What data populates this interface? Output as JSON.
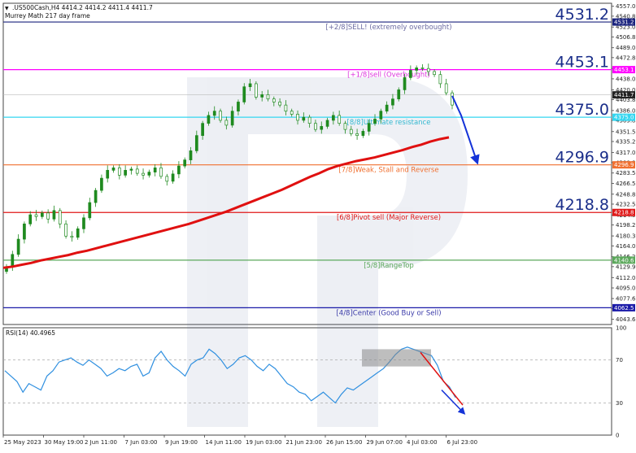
{
  "header": {
    "symbol_line": ".US500Cash,H4  4414.2 4414.2 4411.4 4411.7",
    "indicator_name": "Murrey Math 217 day frame"
  },
  "rsi": {
    "label": "RSI(14) 40.4965",
    "ticks": [
      "100",
      "70",
      "30",
      "0"
    ]
  },
  "colors": {
    "candle": "#1f8a1f",
    "ma": "#e01010",
    "rsi_line": "#3090e0",
    "arrow": "#1533d8",
    "big_label": "#1a2e8a"
  },
  "chart_data": [
    {
      "type": "candlestick",
      "title": ".US500Cash,H4",
      "ylim": [
        4035,
        4562
      ],
      "y_ticks": [
        "4557.0",
        "4540.8",
        "4523.0",
        "4506.8",
        "4489.0",
        "4472.8",
        "4455.0",
        "4438.0",
        "4420.0",
        "4403.8",
        "4386.0",
        "4369.8",
        "4351.5",
        "4335.2",
        "4317.0",
        "4300.8",
        "4283.5",
        "4266.5",
        "4248.8",
        "4232.5",
        "4214.5",
        "4198.2",
        "4180.3",
        "4164.0",
        "4146.2",
        "4129.9",
        "4112.0",
        "4095.0",
        "4077.6",
        "4060.8",
        "4043.6"
      ],
      "x_ticks": [
        "25 May 2023",
        "30 May 19:00",
        "2 Jun 11:00",
        "7 Jun 03:00",
        "9 Jun 19:00",
        "14 Jun 11:00",
        "19 Jun 03:00",
        "21 Jun 23:00",
        "26 Jun 15:00",
        "29 Jun 07:00",
        "4 Jul 03:00",
        "6 Jul 23:00"
      ],
      "current_price": "4411.7",
      "closes": [
        4130,
        4150,
        4175,
        4200,
        4215,
        4212,
        4218,
        4208,
        4222,
        4200,
        4180,
        4178,
        4192,
        4210,
        4235,
        4255,
        4275,
        4288,
        4292,
        4280,
        4288,
        4290,
        4283,
        4280,
        4285,
        4292,
        4278,
        4270,
        4282,
        4295,
        4305,
        4320,
        4345,
        4365,
        4378,
        4385,
        4370,
        4362,
        4385,
        4400,
        4425,
        4430,
        4408,
        4412,
        4405,
        4400,
        4395,
        4385,
        4380,
        4370,
        4375,
        4365,
        4355,
        4360,
        4370,
        4378,
        4365,
        4355,
        4348,
        4345,
        4352,
        4365,
        4372,
        4385,
        4395,
        4405,
        4420,
        4440,
        4452,
        4456,
        4455,
        4450,
        4445,
        4430,
        4415,
        4395
      ],
      "moving_average": {
        "label": "217 MA",
        "values": [
          4128,
          4130,
          4133,
          4136,
          4140,
          4143,
          4146,
          4149,
          4153,
          4156,
          4160,
          4164,
          4168,
          4172,
          4176,
          4180,
          4184,
          4188,
          4192,
          4196,
          4200,
          4205,
          4210,
          4215,
          4220,
          4226,
          4232,
          4238,
          4244,
          4250,
          4256,
          4263,
          4270,
          4277,
          4283,
          4290,
          4295,
          4299,
          4303,
          4306,
          4309,
          4313,
          4317,
          4321,
          4326,
          4330,
          4335,
          4339,
          4342
        ]
      },
      "murrey_levels": [
        {
          "price": 4531.2,
          "price_label": "4531.2",
          "big_label": "4531.2",
          "text": "[+2/8]SELL! (extremely overbought)",
          "color": "#1a237e",
          "text_color": "#6c6ca2",
          "dashed": false
        },
        {
          "price": 4453.1,
          "price_label": "4453.1",
          "big_label": "4453.1",
          "text": "[+1/8]sell (Overbought)",
          "color": "#ff00ff",
          "text_color": "#dd33dd",
          "dashed": false
        },
        {
          "price": 4375.0,
          "price_label": "4375.0",
          "big_label": "4375.0",
          "text": "[8/8]Ultimate resistance",
          "color": "#33d6f0",
          "text_color": "#33b8d0",
          "dashed": false
        },
        {
          "price": 4296.9,
          "price_label": "4296.9",
          "big_label": "4296.9",
          "text": "[7/8]Weak, Stall and Reverse",
          "color": "#f07030",
          "text_color": "#f07030",
          "dashed": false
        },
        {
          "price": 4218.8,
          "price_label": "4218.8",
          "big_label": "4218.8",
          "text": "[6/8]Pivot sell (Major Reverse)",
          "color": "#e01818",
          "text_color": "#e01818",
          "dashed": false
        },
        {
          "price": 4140.6,
          "price_label": "4140.6",
          "big_label": "",
          "text": "[5/8]RangeTop",
          "color": "#5ba85b",
          "text_color": "#5ba85b",
          "dashed": false
        },
        {
          "price": 4062.5,
          "price_label": "4062.5",
          "big_label": "",
          "text": "[4/8]Center (Good Buy or Sell)",
          "color": "#1a1aa8",
          "text_color": "#3a3aa8",
          "dashed": false
        }
      ]
    },
    {
      "type": "line",
      "title": "RSI(14) 40.4965",
      "ylim": [
        0,
        100
      ],
      "levels": [
        70,
        30
      ],
      "values": [
        60,
        55,
        50,
        40,
        48,
        45,
        42,
        55,
        60,
        68,
        70,
        72,
        68,
        65,
        70,
        66,
        62,
        55,
        58,
        62,
        60,
        64,
        66,
        55,
        58,
        72,
        78,
        70,
        64,
        60,
        55,
        66,
        70,
        72,
        80,
        76,
        70,
        62,
        66,
        72,
        74,
        70,
        64,
        60,
        66,
        62,
        55,
        48,
        45,
        40,
        38,
        32,
        36,
        40,
        35,
        30,
        38,
        44,
        42,
        46,
        50,
        54,
        58,
        62,
        68,
        75,
        80,
        82,
        80,
        78,
        76,
        74,
        65,
        50,
        45,
        35
      ]
    }
  ]
}
